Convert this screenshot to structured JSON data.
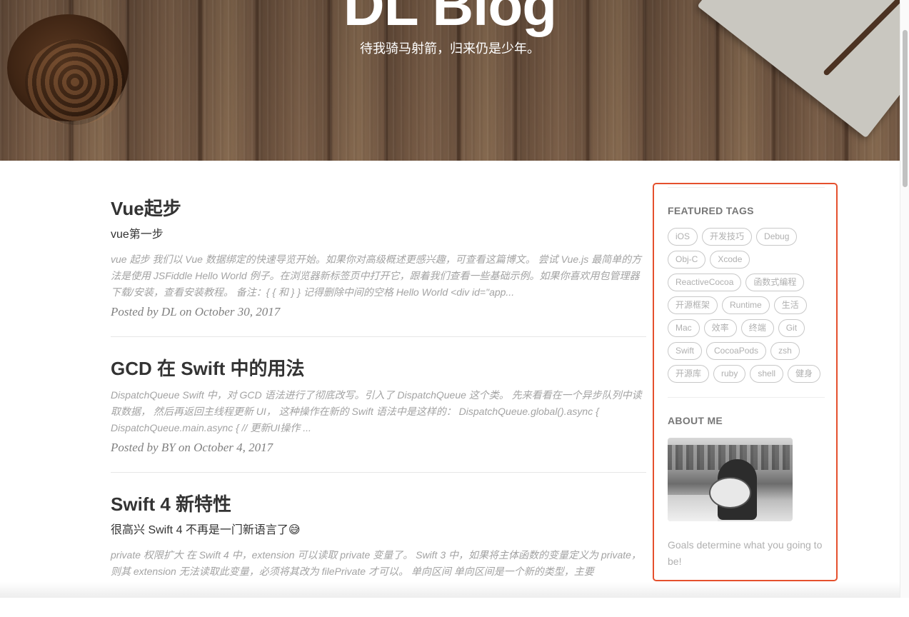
{
  "header": {
    "title": "DL Blog",
    "subtitle": "待我骑马射箭，归来仍是少年。"
  },
  "posts": [
    {
      "title": "Vue起步",
      "subtitle": "vue第一步",
      "excerpt": "vue 起步 我们以 Vue 数据绑定的快速导览开始。如果你对高级概述更感兴趣，可查看这篇博文。 尝试 Vue.js 最简单的方法是使用 JSFiddle Hello World 例子。在浏览器新标签页中打开它，跟着我们查看一些基础示例。如果你喜欢用包管理器下载/安装，查看安装教程。 备注：{ { 和 } } 记得删除中间的空格 Hello World <div id=\"app...",
      "meta_prefix": "Posted by DL on October 30, 2017"
    },
    {
      "title": "GCD 在 Swift 中的用法",
      "subtitle": "",
      "excerpt": "DispatchQueue Swift 中，对 GCD 语法进行了彻底改写。引入了 DispatchQueue 这个类。 先来看看在一个异步队列中读取数据， 然后再返回主线程更新 UI， 这种操作在新的 Swift 语法中是这样的： DispatchQueue.global().async { DispatchQueue.main.async { // 更新UI操作 ...",
      "meta_prefix": "Posted by BY on October 4, 2017"
    },
    {
      "title": "Swift 4 新特性",
      "subtitle": "很高兴 Swift 4 不再是一门新语言了😅",
      "excerpt": "private 权限扩大 在 Swift 4 中，extension 可以读取 private 变量了。 Swift 3 中，如果将主体函数的变量定义为 private，则其 extension 无法读取此变量，必须将其改为 filePrivate 才可以。 单向区间 单向区间是一个新的类型，主要",
      "meta_prefix": ""
    }
  ],
  "sidebar": {
    "tags_title": "FEATURED TAGS",
    "tags": [
      "iOS",
      "开发技巧",
      "Debug",
      "Obj-C",
      "Xcode",
      "ReactiveCocoa",
      "函数式编程",
      "开源框架",
      "Runtime",
      "生活",
      "Mac",
      "效率",
      "终端",
      "Git",
      "Swift",
      "CocoaPods",
      "zsh",
      "开源库",
      "ruby",
      "shell",
      "健身"
    ],
    "about_title": "ABOUT ME",
    "about_text": "Goals determine what you going to be!"
  },
  "colors": {
    "highlight": "#e5502d",
    "tag_border": "#c8c8c8",
    "excerpt": "#a3a3a3"
  }
}
